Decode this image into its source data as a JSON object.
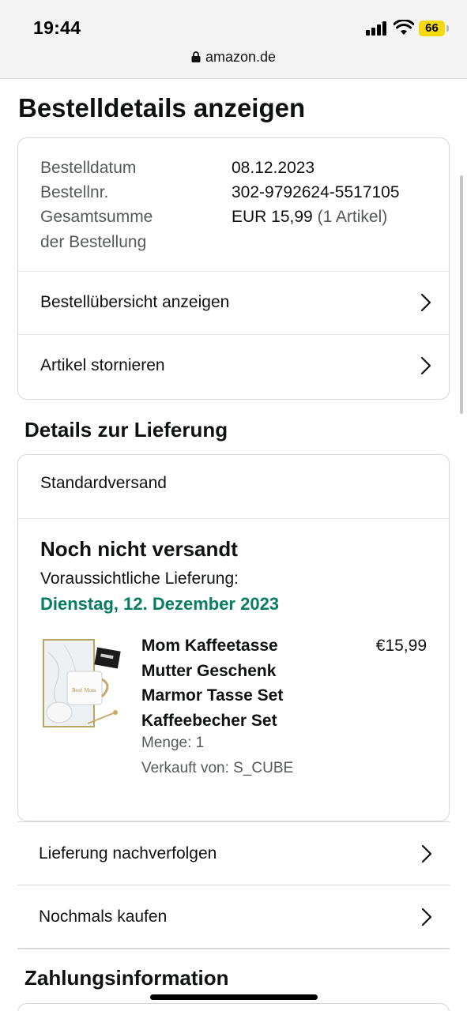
{
  "status_bar": {
    "time": "19:44",
    "battery": "66",
    "url": "amazon.de"
  },
  "page_title": "Bestelldetails anzeigen",
  "order_summary": {
    "rows": [
      {
        "label": "Bestelldatum",
        "value": "08.12.2023"
      },
      {
        "label": "Bestellnr.",
        "value": "302-9792624-5517105"
      },
      {
        "label": "Gesamtsumme",
        "label2": "der Bestellung",
        "value": "EUR 15,99",
        "value_suffix": "(1 Artikel)"
      }
    ],
    "links": [
      "Bestellübersicht anzeigen",
      "Artikel stornieren"
    ]
  },
  "delivery": {
    "section_title": "Details zur Lieferung",
    "shipping_method": "Standardversand",
    "status": "Noch nicht versandt",
    "eta_label": "Voraussichtliche Lieferung:",
    "eta_date": "Dienstag, 12. Dezember 2023",
    "item": {
      "title_lines": [
        "Mom Kaffeetasse",
        "Mutter Geschenk",
        "Marmor Tasse Set",
        "Kaffeebecher Set"
      ],
      "price": "€15,99",
      "quantity": "Menge: 1",
      "seller": "Verkauft von: S_CUBE"
    },
    "links": [
      "Lieferung nachverfolgen",
      "Nochmals kaufen"
    ]
  },
  "payment": {
    "section_title": "Zahlungsinformation"
  },
  "colors": {
    "eta_green": "#067d62",
    "battery_yellow": "#f5d90a",
    "border": "#d5d9d9"
  },
  "icons": [
    "lock-icon",
    "signal-icon",
    "wifi-icon",
    "battery-icon",
    "chevron-right-icon"
  ]
}
